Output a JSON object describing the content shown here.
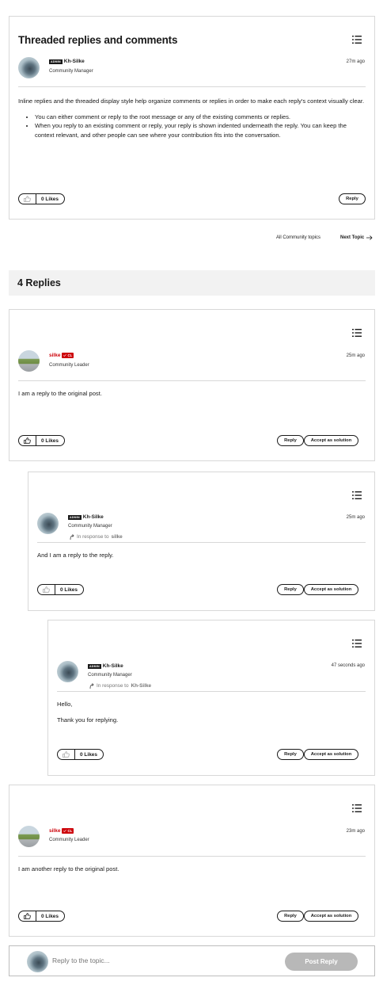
{
  "topic": {
    "title": "Threaded replies and comments",
    "author": "Kh-Silke",
    "admin_badge": "ADMIN",
    "role": "Community Manager",
    "time": "27m ago",
    "paragraph": "Inline replies and the threaded display style help organize comments or replies in order to make each reply's context visually clear.",
    "bullets": [
      "You can either comment or reply to the root message or any of the existing comments or replies.",
      "When you reply to an existing comment or reply, your reply is shown indented underneath the reply. You can keep the context relevant, and other people can see where your contribution fits into the conversation."
    ],
    "likes": "0 Likes",
    "reply_label": "Reply"
  },
  "nav": {
    "all_topics": "All Community topics",
    "next_topic": "Next Topic"
  },
  "replies_header": "4 Replies",
  "replies": [
    {
      "author": "silke",
      "badge": "CL",
      "role": "Community Leader",
      "time": "25m ago",
      "body": "I am a reply to the original post.",
      "likes": "0 Likes",
      "reply_label": "Reply",
      "solution_label": "Accept as solution"
    },
    {
      "author": "Kh-Silke",
      "admin_badge": "ADMIN",
      "role": "Community Manager",
      "in_response_prefix": "In response to",
      "in_response_to": "silke",
      "time": "25m ago",
      "body": "And I am a reply to the reply.",
      "likes": "0 Likes",
      "reply_label": "Reply",
      "solution_label": "Accept as solution"
    },
    {
      "author": "Kh-Silke",
      "admin_badge": "ADMIN",
      "role": "Community Manager",
      "in_response_prefix": "In response to",
      "in_response_to": "Kh-Silke",
      "time": "47 seconds ago",
      "body_line1": "Hello,",
      "body_line2": "Thank you for replying.",
      "likes": "0 Likes",
      "reply_label": "Reply",
      "solution_label": "Accept as solution"
    },
    {
      "author": "silke",
      "badge": "CL",
      "role": "Community Leader",
      "time": "23m ago",
      "body": "I am another reply to the original post.",
      "likes": "0 Likes",
      "reply_label": "Reply",
      "solution_label": "Accept as solution"
    }
  ],
  "composer": {
    "placeholder": "Reply to the topic...",
    "post_button": "Post Reply"
  },
  "colors": {
    "brand_red": "#cd040b",
    "border": "#d8d8d8",
    "muted": "#767676",
    "disabled_button": "#b8b8b8"
  },
  "icons": [
    "menu-list-icon",
    "thumbs-up-icon",
    "arrow-right-icon",
    "reply-arrow-icon",
    "check-icon"
  ]
}
